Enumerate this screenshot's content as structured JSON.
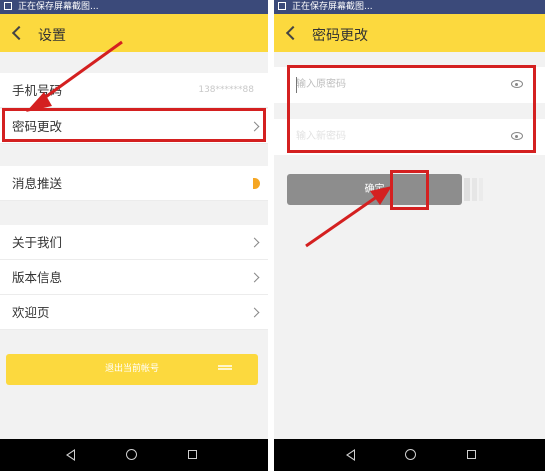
{
  "status_bar": {
    "text": "正在保存屏幕截图..."
  },
  "settings_screen": {
    "title": "设置",
    "items": [
      {
        "label": "手机号码",
        "value": "138******88"
      },
      {
        "label": "密码更改"
      },
      {
        "label": "消息推送"
      },
      {
        "label": "关于我们"
      },
      {
        "label": "版本信息"
      },
      {
        "label": "欢迎页"
      }
    ],
    "logout_label": "退出当前帐号"
  },
  "password_screen": {
    "title": "密码更改",
    "old_password_placeholder": "输入原密码",
    "new_password_placeholder": "输入新密码",
    "confirm_label": "确定"
  },
  "colors": {
    "accent": "#fcd93e",
    "highlight": "#d42020",
    "status_bar": "#3b4a7a",
    "confirm_button": "#8d8d8d"
  }
}
